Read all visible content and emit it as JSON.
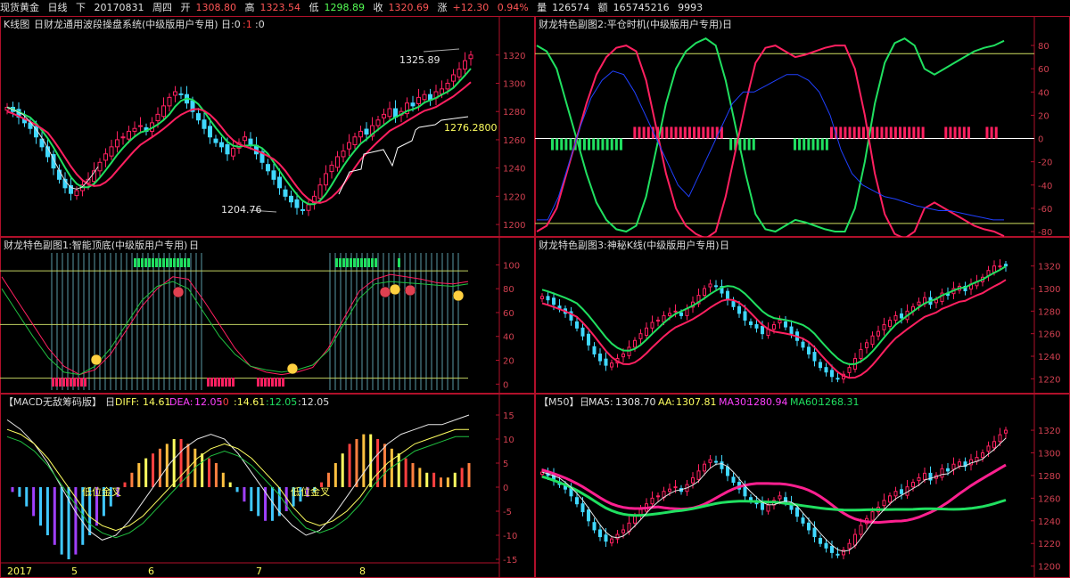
{
  "topbar": {
    "name": "现货黄金",
    "period": "日线",
    "dir": "下",
    "date": "20170831",
    "weekday": "周四",
    "open_label": "开",
    "open": "1308.80",
    "high_label": "高",
    "high": "1323.54",
    "low_label": "低",
    "low": "1298.89",
    "close_label": "收",
    "close": "1320.69",
    "chg_label": "涨",
    "chg": "+12.30",
    "chg_pct": "0.94%",
    "vol_label": "量",
    "vol": "126574",
    "amt_label": "额",
    "amt": "165745216",
    "extra": "9993"
  },
  "panels": {
    "kline": {
      "title": "K线图",
      "subtitle": "日财龙通用波段操盘系统(中级版用户专用)",
      "flags": [
        "日:0",
        ":1",
        ":0"
      ],
      "peak_label": "1325.89",
      "trough_label": "1204.76",
      "stop_label": "1276.2800"
    },
    "sub2": {
      "title": "财龙特色副图2:平仓时机(中级版用户专用)",
      "box": "日"
    },
    "sub1": {
      "title": "财龙特色副图1:智能顶底(中级版用户专用)",
      "box": "日"
    },
    "sub3": {
      "title": "财龙特色副图3:神秘K线(中级版用户专用)",
      "box": "日"
    },
    "macd": {
      "title": "【MACD无敌筹码版】",
      "box": "日",
      "diff_label": "DIFF:",
      "diff": "14.61",
      "dea_label": "DEA:",
      "dea": "12.05",
      "v0": ":0",
      "v1": ":14.61",
      "v2": ":12.05",
      "v3": ":12.05",
      "cross_label_1": "低位金叉",
      "cross_label_2": "低位金叉"
    },
    "ma": {
      "title": "【M50】",
      "box": "日",
      "ma5_label": "MA5:",
      "ma5": "1308.70",
      "aa_label": "AA:",
      "aa": "1307.81",
      "ma30_label": "MA30:",
      "ma30": "1280.94",
      "ma60_label": "MA60:",
      "ma60": "1268.31"
    }
  },
  "xaxis": {
    "year": "2017",
    "months": [
      "5",
      "6",
      "7",
      "8"
    ]
  },
  "chart_data": [
    {
      "type": "candlestick",
      "name": "K线图",
      "xlabel": "",
      "ylabel": "",
      "ylim": [
        1195,
        1335
      ],
      "y_ticks": [
        1200,
        1220,
        1240,
        1260,
        1280,
        1300,
        1320
      ],
      "x_months": [
        "5",
        "6",
        "7",
        "8"
      ],
      "close": [
        1283,
        1280,
        1276,
        1272,
        1268,
        1262,
        1255,
        1248,
        1240,
        1232,
        1226,
        1222,
        1224,
        1228,
        1232,
        1238,
        1244,
        1250,
        1255,
        1260,
        1262,
        1266,
        1268,
        1270,
        1266,
        1272,
        1278,
        1284,
        1290,
        1294,
        1292,
        1286,
        1280,
        1274,
        1268,
        1262,
        1258,
        1255,
        1250,
        1254,
        1258,
        1262,
        1256,
        1250,
        1244,
        1238,
        1232,
        1226,
        1220,
        1216,
        1212,
        1210,
        1214,
        1220,
        1228,
        1236,
        1242,
        1248,
        1252,
        1258,
        1262,
        1266,
        1264,
        1270,
        1274,
        1278,
        1282,
        1276,
        1280,
        1286,
        1284,
        1290,
        1292,
        1288,
        1294,
        1296,
        1300,
        1306,
        1310,
        1316,
        1320
      ],
      "annotations": [
        "1325.89",
        "1204.76",
        "1276.2800"
      ]
    },
    {
      "type": "line",
      "name": "财龙特色副图2:平仓时机",
      "ylim": [
        -80,
        90
      ],
      "y_ticks": [
        -80,
        -60,
        -40,
        -20,
        0,
        20,
        40,
        60,
        80
      ],
      "series": [
        {
          "values": [
            80,
            75,
            60,
            30,
            0,
            -30,
            -55,
            -70,
            -78,
            -80,
            -75,
            -50,
            -10,
            30,
            60,
            75,
            82,
            86,
            80,
            50,
            10,
            -30,
            -65,
            -78,
            -80,
            -75,
            -70,
            -72,
            -75,
            -78,
            -80,
            -80,
            -60,
            -20,
            30,
            65,
            82,
            86,
            80,
            60,
            55,
            60,
            65,
            70,
            75,
            78,
            80,
            84
          ]
        },
        {
          "values": [
            -70,
            -70,
            -50,
            -20,
            10,
            35,
            50,
            58,
            55,
            40,
            20,
            0,
            -20,
            -40,
            -50,
            -30,
            -10,
            10,
            30,
            40,
            40,
            45,
            50,
            55,
            55,
            50,
            40,
            20,
            -10,
            -30,
            -40,
            -45,
            -50,
            -52,
            -55,
            -58,
            -60,
            -62,
            -62,
            -64,
            -66,
            -68,
            -70,
            -70
          ]
        }
      ],
      "reference_lines": [
        73,
        0,
        -73
      ]
    },
    {
      "type": "line",
      "name": "财龙特色副图1:智能顶底",
      "ylim": [
        -5,
        110
      ],
      "y_ticks": [
        0,
        20,
        40,
        60,
        80,
        100
      ],
      "reference_lines": [
        95,
        50,
        5
      ],
      "series": [
        {
          "values": [
            90,
            70,
            50,
            30,
            15,
            8,
            12,
            25,
            45,
            65,
            80,
            90,
            88,
            70,
            50,
            30,
            15,
            10,
            8,
            10,
            14,
            30,
            55,
            78,
            88,
            92,
            90,
            88,
            85,
            84,
            86
          ]
        },
        {
          "values": [
            80,
            60,
            40,
            22,
            10,
            8,
            15,
            30,
            50,
            70,
            82,
            86,
            80,
            60,
            40,
            25,
            15,
            12,
            10,
            12,
            16,
            28,
            50,
            72,
            84,
            86,
            85,
            84,
            83,
            82,
            84
          ]
        }
      ]
    },
    {
      "type": "candlestick",
      "name": "财龙特色副图3:神秘K线",
      "ylim": [
        1210,
        1330
      ],
      "y_ticks": [
        1220,
        1240,
        1260,
        1280,
        1300,
        1320
      ]
    },
    {
      "type": "bar",
      "name": "MACD无敌筹码版",
      "ylim": [
        -15,
        15
      ],
      "y_ticks": [
        -15,
        -10,
        -5,
        0,
        5,
        10,
        15
      ],
      "values": [
        -1,
        -2,
        -4,
        -6,
        -8,
        -10,
        -12,
        -14,
        -15,
        -14,
        -12,
        -10,
        -8,
        -6,
        -4,
        -2,
        1,
        3,
        5,
        6,
        7,
        8,
        9,
        10,
        10,
        9,
        8,
        7,
        6,
        5,
        3,
        1,
        -1,
        -3,
        -5,
        -6,
        -7,
        -7,
        -6,
        -5,
        -4,
        -3,
        -2,
        -1,
        1,
        3,
        5,
        7,
        9,
        10,
        11,
        11,
        10,
        9,
        8,
        7,
        6,
        5,
        4,
        3,
        3,
        2,
        2,
        3,
        4,
        5
      ],
      "series": [
        {
          "name": "DIFF",
          "values": [
            14,
            12,
            9,
            5,
            0,
            -5,
            -9,
            -11,
            -10,
            -7,
            -3,
            1,
            5,
            8,
            10,
            11,
            10,
            7,
            3,
            -1,
            -5,
            -8,
            -10,
            -9,
            -6,
            -2,
            2,
            6,
            9,
            11,
            12,
            13,
            13,
            14,
            15
          ]
        },
        {
          "name": "DEA",
          "values": [
            12,
            11,
            9,
            6,
            2,
            -2,
            -6,
            -8,
            -9,
            -8,
            -6,
            -3,
            0,
            3,
            6,
            8,
            9,
            8,
            6,
            3,
            0,
            -4,
            -7,
            -8,
            -7,
            -5,
            -2,
            2,
            5,
            7,
            9,
            10,
            11,
            12,
            12
          ]
        }
      ]
    },
    {
      "type": "candlestick",
      "name": "M50",
      "ylim": [
        1195,
        1335
      ],
      "y_ticks": [
        1200,
        1220,
        1240,
        1260,
        1280,
        1300,
        1320
      ],
      "series": [
        {
          "name": "MA5",
          "value": 1308.7
        },
        {
          "name": "AA",
          "value": 1307.81
        },
        {
          "name": "MA30",
          "value": 1280.94
        },
        {
          "name": "MA60",
          "value": 1268.31
        }
      ]
    }
  ],
  "colors": {
    "bg": "#000000",
    "frame": "#b0102a",
    "up": "#ff2060",
    "down": "#40d8ff",
    "green": "#20e060",
    "yellow": "#ffff60"
  }
}
